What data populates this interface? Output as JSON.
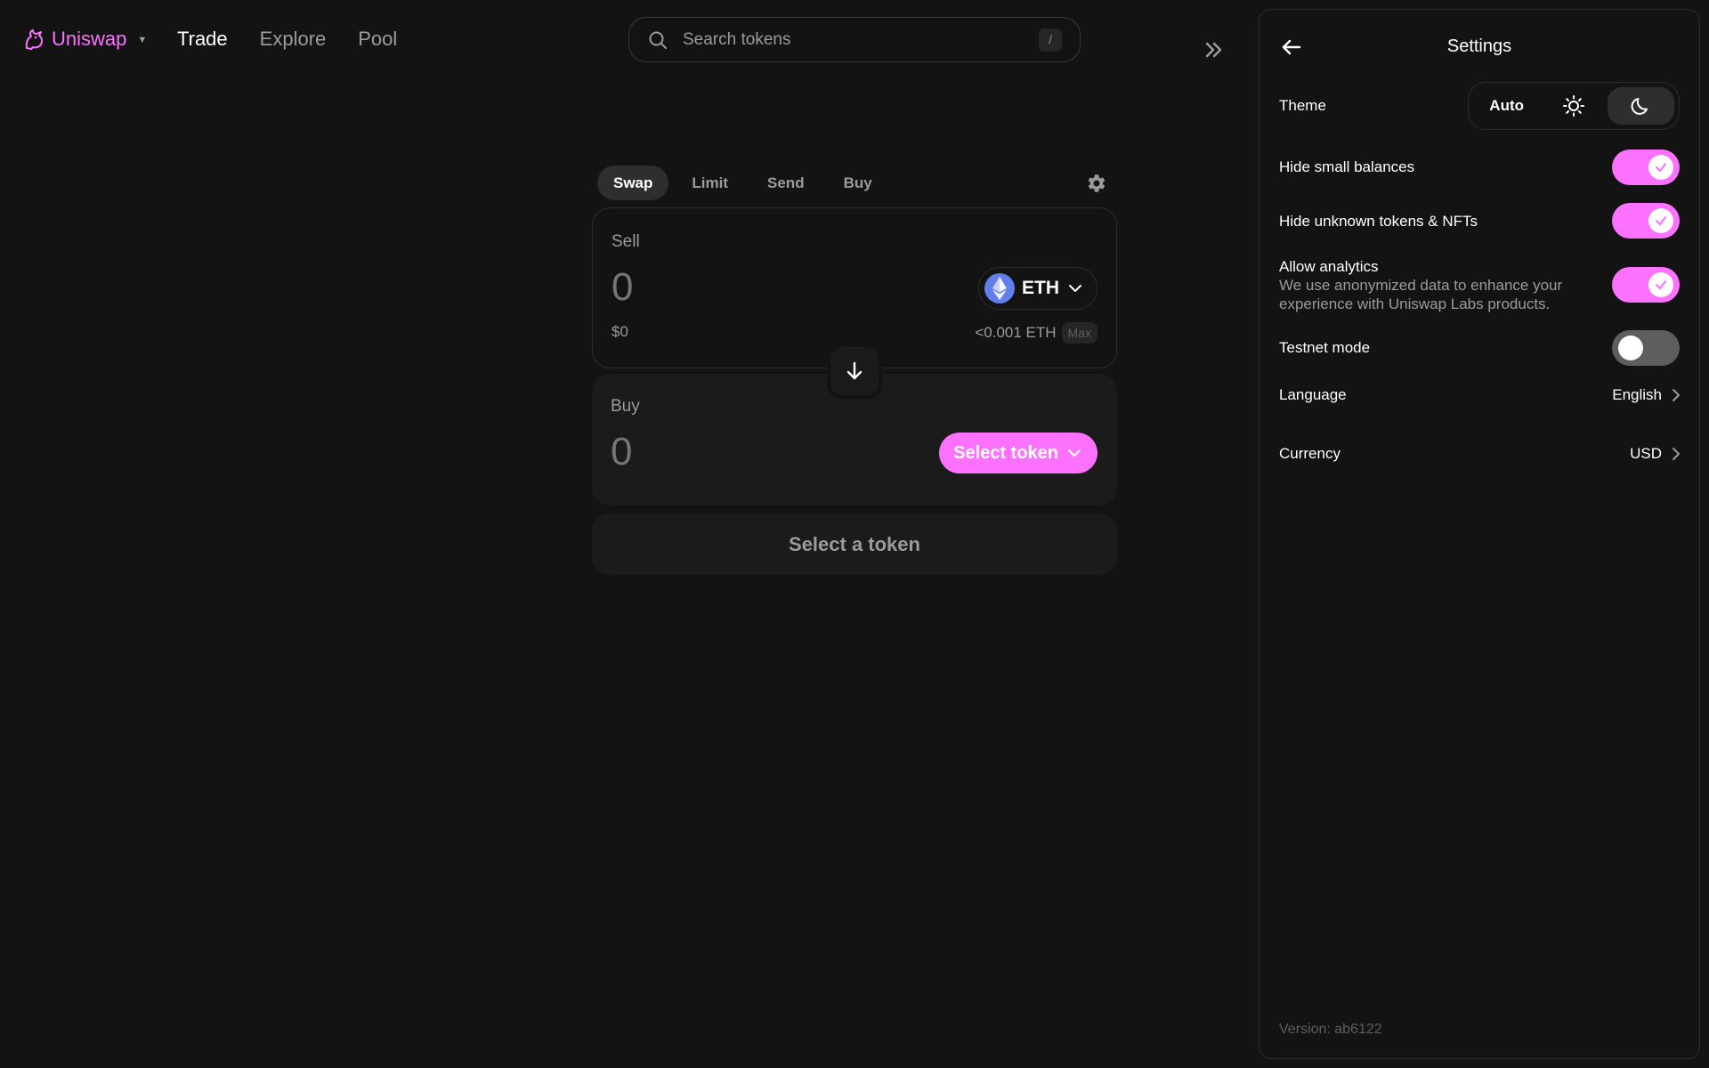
{
  "colors": {
    "accent": "#fc72ff",
    "background": "#131313",
    "surface": "#1b1b1b",
    "muted_text": "#9b9b9b"
  },
  "nav": {
    "brand": "Uniswap",
    "brand_icon": "uniswap-unicorn-icon",
    "links": [
      {
        "label": "Trade",
        "active": true
      },
      {
        "label": "Explore",
        "active": false
      },
      {
        "label": "Pool",
        "active": false
      }
    ],
    "search": {
      "placeholder": "Search tokens",
      "value": "",
      "shortcut": "/"
    },
    "collapse_icon": "double-chevron-right-icon"
  },
  "swap": {
    "tabs": [
      {
        "label": "Swap",
        "active": true
      },
      {
        "label": "Limit",
        "active": false
      },
      {
        "label": "Send",
        "active": false
      },
      {
        "label": "Buy",
        "active": false
      }
    ],
    "settings_icon": "gear-icon",
    "sell": {
      "label": "Sell",
      "amount_placeholder": "0",
      "fiat": "$0",
      "token": "ETH",
      "balance": "<0.001 ETH",
      "max_label": "Max"
    },
    "flip_icon": "arrow-down-icon",
    "buy": {
      "label": "Buy",
      "amount_placeholder": "0",
      "select_label": "Select token"
    },
    "cta": "Select a token"
  },
  "settings": {
    "title": "Settings",
    "theme": {
      "label": "Theme",
      "options": [
        {
          "label": "Auto",
          "active": false
        },
        {
          "icon": "sun-icon",
          "active": false
        },
        {
          "icon": "moon-icon",
          "active": true
        }
      ]
    },
    "hide_small_balances": {
      "label": "Hide small balances",
      "on": true
    },
    "hide_unknown": {
      "label": "Hide unknown tokens & NFTs",
      "on": true
    },
    "analytics": {
      "label": "Allow analytics",
      "description": "We use anonymized data to enhance your experience with Uniswap Labs products.",
      "on": true
    },
    "testnet": {
      "label": "Testnet mode",
      "on": false
    },
    "language": {
      "label": "Language",
      "value": "English"
    },
    "currency": {
      "label": "Currency",
      "value": "USD"
    },
    "version": "Version: ab6122"
  }
}
